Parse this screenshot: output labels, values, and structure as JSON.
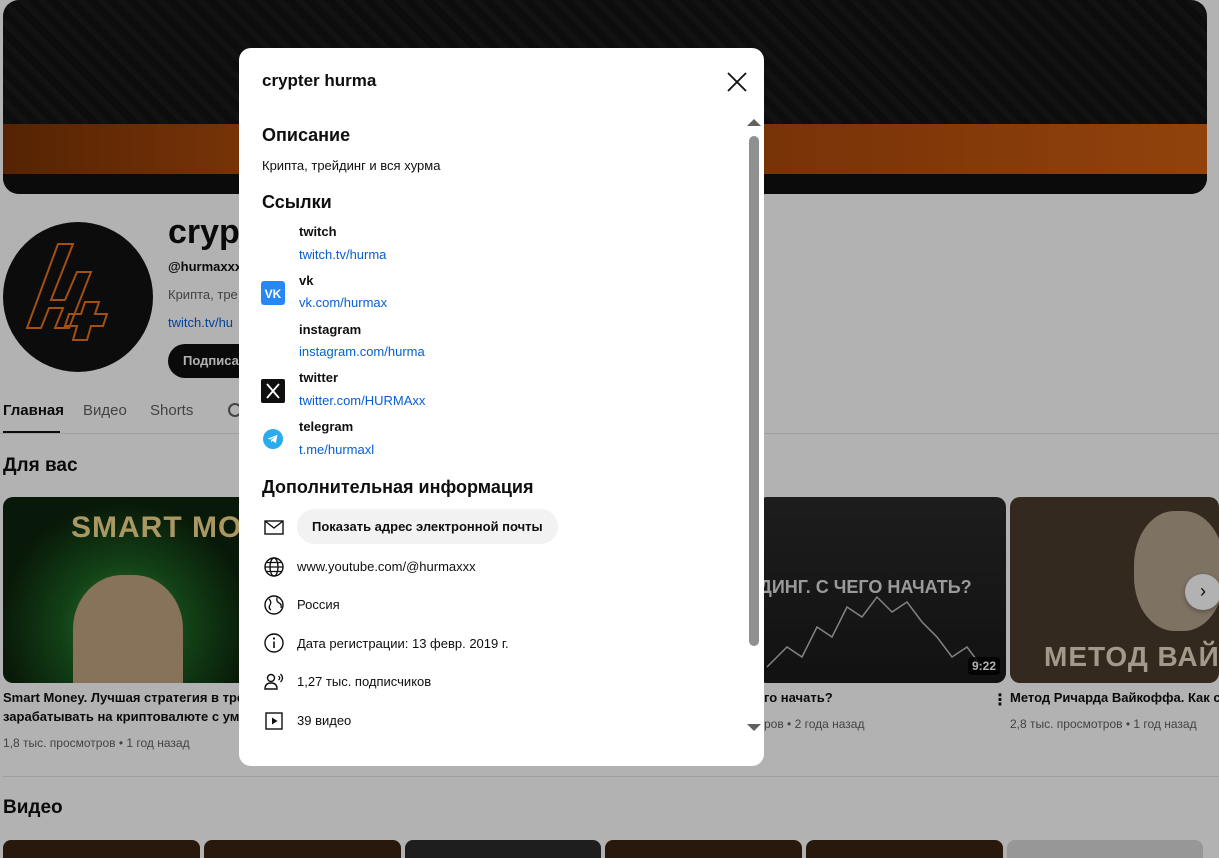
{
  "channel": {
    "name": "crypt",
    "handle": "@hurmaxxx",
    "description_short": "Крипта, тре",
    "link_short": "twitch.tv/hu",
    "subscribe_label": "Подписат"
  },
  "tabs": [
    {
      "label": "Главная"
    },
    {
      "label": "Видео"
    },
    {
      "label": "Shorts"
    }
  ],
  "sections": {
    "for_you": "Для вас",
    "videos": "Видео"
  },
  "videos": [
    {
      "title_line1": "Smart Money. Лучшая стратегия в трей",
      "title_line2": "зарабатывать на криптовалюте с умо",
      "meta": "1,8 тыс. просмотров • 1 год назад",
      "thumb_text": "SMART MONE"
    },
    {
      "title_line1": "го начать?",
      "meta": "ров • 2 года назад",
      "thumb_text": "ДИНГ. С ЧЕГО НАЧАТЬ?",
      "duration": "9:22"
    },
    {
      "title_line1": "Метод Ричарда Вайкоффа. Как с",
      "meta": "2,8 тыс. просмотров • 1 год назад",
      "thumb_text": "МЕТОД ВАЙ"
    }
  ],
  "dialog": {
    "title": "crypter hurma",
    "description_heading": "Описание",
    "description": "Крипта, трейдинг и вся хурма",
    "links_heading": "Ссылки",
    "links": [
      {
        "name": "twitch",
        "url": "twitch.tv/hurma",
        "icon": "none"
      },
      {
        "name": "vk",
        "url": "vk.com/hurmax",
        "icon": "vk-icon"
      },
      {
        "name": "instagram",
        "url": "instagram.com/hurma",
        "icon": "none"
      },
      {
        "name": "twitter",
        "url": "twitter.com/HURMAxx",
        "icon": "x-icon"
      },
      {
        "name": "telegram",
        "url": "t.me/hurmaxl",
        "icon": "telegram-icon"
      }
    ],
    "extra_heading": "Дополнительная информация",
    "email_button": "Показать адрес электронной почты",
    "channel_url": "www.youtube.com/@hurmaxxx",
    "country": "Россия",
    "joined": "Дата регистрации: 13 февр. 2019 г.",
    "subscribers": "1,27 тыс. подписчиков",
    "video_count": "39 видео"
  },
  "colors": {
    "link": "#065fd4",
    "vk": "#2787f5",
    "telegram": "#2aabee",
    "banner_orange": "#c4560d"
  }
}
